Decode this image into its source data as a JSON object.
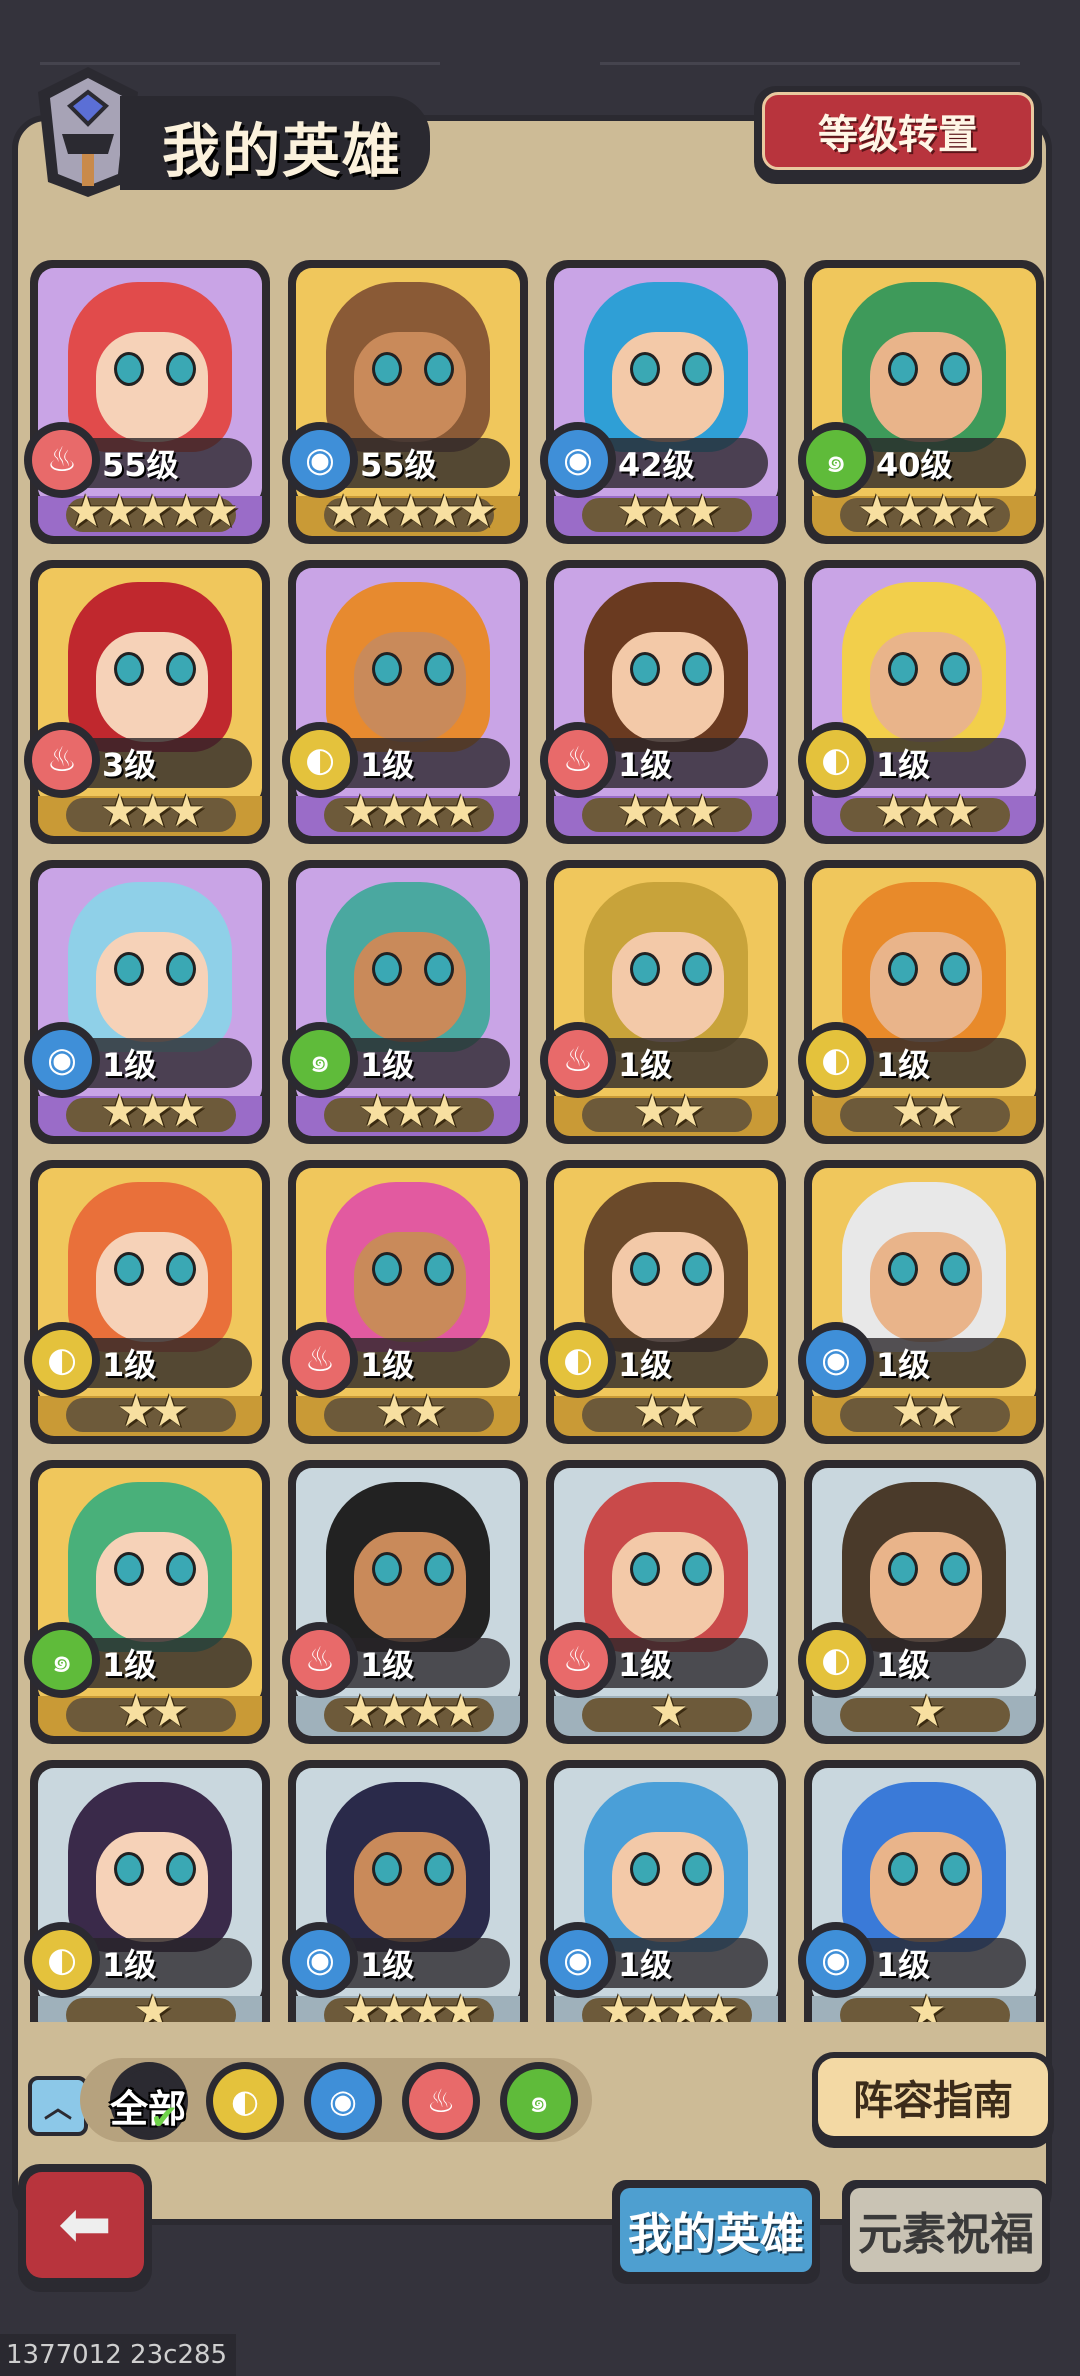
{
  "header": {
    "title": "我的英雄",
    "level_transfer_label": "等级转置"
  },
  "elements": {
    "fire": {
      "color": "#e86a6a",
      "icon": "fire-icon"
    },
    "water": {
      "color": "#3f8fd8",
      "icon": "water-icon"
    },
    "wind": {
      "color": "#5fbb3a",
      "icon": "wind-icon"
    },
    "earth": {
      "color": "#e4c23c",
      "icon": "earth-icon"
    }
  },
  "heroes": [
    {
      "level": "55级",
      "element": "fire",
      "stars": 5,
      "rarity": "purple"
    },
    {
      "level": "55级",
      "element": "water",
      "stars": 5,
      "rarity": "gold"
    },
    {
      "level": "42级",
      "element": "water",
      "stars": 3,
      "rarity": "purple"
    },
    {
      "level": "40级",
      "element": "wind",
      "stars": 4,
      "rarity": "gold"
    },
    {
      "level": "3级",
      "element": "fire",
      "stars": 3,
      "rarity": "gold"
    },
    {
      "level": "1级",
      "element": "earth",
      "stars": 4,
      "rarity": "purple"
    },
    {
      "level": "1级",
      "element": "fire",
      "stars": 3,
      "rarity": "purple"
    },
    {
      "level": "1级",
      "element": "earth",
      "stars": 3,
      "rarity": "purple"
    },
    {
      "level": "1级",
      "element": "water",
      "stars": 3,
      "rarity": "purple"
    },
    {
      "level": "1级",
      "element": "wind",
      "stars": 3,
      "rarity": "purple"
    },
    {
      "level": "1级",
      "element": "fire",
      "stars": 2,
      "rarity": "gold"
    },
    {
      "level": "1级",
      "element": "earth",
      "stars": 2,
      "rarity": "gold"
    },
    {
      "level": "1级",
      "element": "earth",
      "stars": 2,
      "rarity": "gold"
    },
    {
      "level": "1级",
      "element": "fire",
      "stars": 2,
      "rarity": "gold"
    },
    {
      "level": "1级",
      "element": "earth",
      "stars": 2,
      "rarity": "gold"
    },
    {
      "level": "1级",
      "element": "water",
      "stars": 2,
      "rarity": "gold"
    },
    {
      "level": "1级",
      "element": "wind",
      "stars": 2,
      "rarity": "gold"
    },
    {
      "level": "1级",
      "element": "fire",
      "stars": 4,
      "rarity": "silver"
    },
    {
      "level": "1级",
      "element": "fire",
      "stars": 1,
      "rarity": "silver"
    },
    {
      "level": "1级",
      "element": "earth",
      "stars": 1,
      "rarity": "silver"
    },
    {
      "level": "1级",
      "element": "earth",
      "stars": 1,
      "rarity": "silver"
    },
    {
      "level": "1级",
      "element": "water",
      "stars": 4,
      "rarity": "silver"
    },
    {
      "level": "1级",
      "element": "water",
      "stars": 4,
      "rarity": "silver"
    },
    {
      "level": "1级",
      "element": "water",
      "stars": 1,
      "rarity": "silver"
    }
  ],
  "rarity_colors": {
    "purple": {
      "face": "#c9a4e6",
      "base": "#9a6cc8"
    },
    "gold": {
      "face": "#f0c75c",
      "base": "#c99a36"
    },
    "silver": {
      "face": "#c9d7de",
      "base": "#9fb1bb"
    }
  },
  "filter": {
    "all_label": "全部",
    "elements": [
      "earth",
      "water",
      "fire",
      "wind"
    ]
  },
  "lineup_guide_label": "阵容指南",
  "tabs": [
    {
      "label": "我的英雄",
      "active": true
    },
    {
      "label": "元素祝福",
      "active": false
    }
  ],
  "footer_id": "1377012 23c285"
}
